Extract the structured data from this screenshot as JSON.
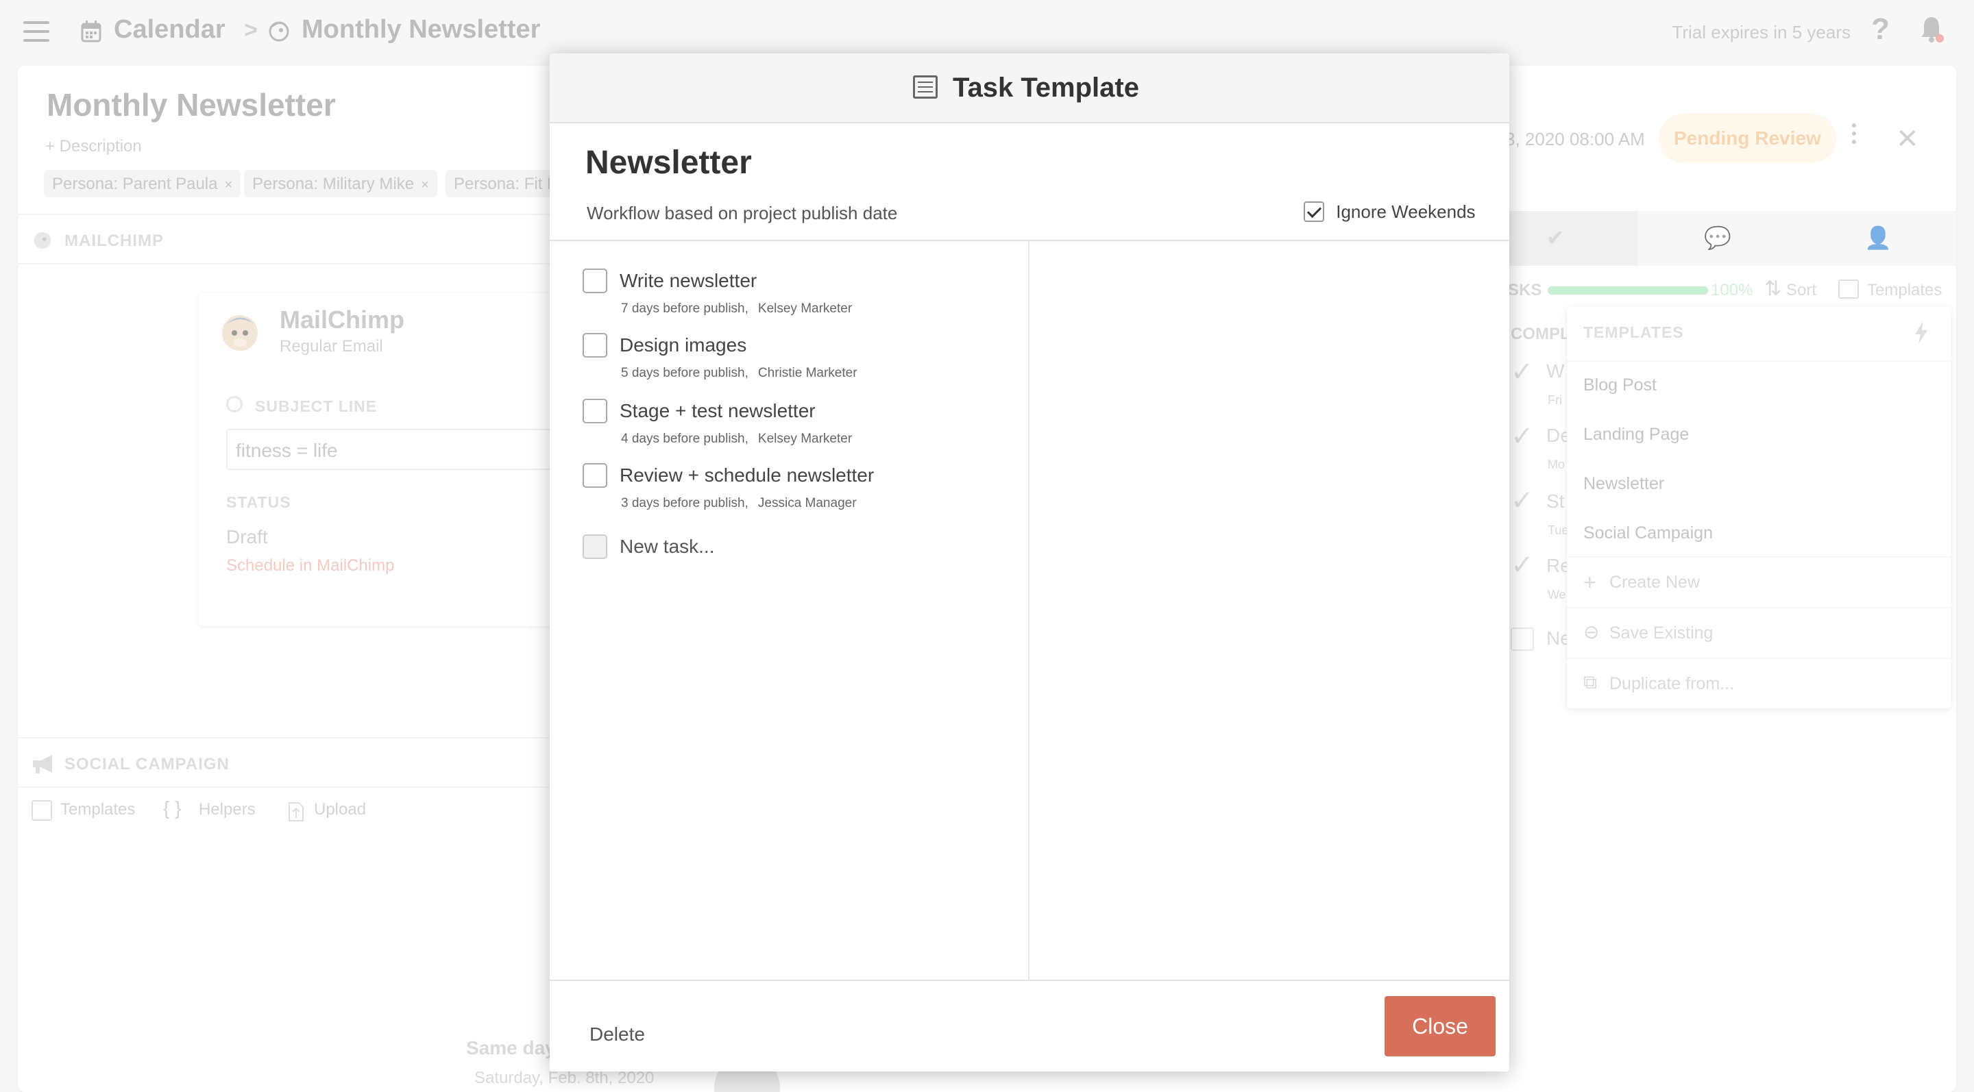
{
  "topbar": {
    "crumb_calendar": "Calendar",
    "crumb_separator": ">",
    "crumb_project": "Monthly Newsletter",
    "trial_text": "Trial expires in 5 years",
    "help_icon": "?"
  },
  "project": {
    "title": "Monthly Newsletter",
    "description_link": "+ Description",
    "tags": [
      "Persona: Parent Paula",
      "Persona: Military Mike",
      "Persona: Fit L"
    ],
    "tag_remove": "×",
    "date_text": "3, 2020 08:00 AM",
    "status_badge": "Pending Review",
    "close_icon": "✕"
  },
  "mailchimp_section": {
    "header": "MAILCHIMP",
    "card_title": "MailChimp",
    "card_subtitle": "Regular Email",
    "subject_label": "SUBJECT LINE",
    "subject_value": "fitness = life",
    "status_label": "STATUS",
    "status_value": "Draft",
    "schedule_link": "Schedule in MailChimp"
  },
  "social_section": {
    "header": "SOCIAL CAMPAIGN",
    "toolbar": {
      "templates": "Templates",
      "helpers_icon": "{ }",
      "helpers": "Helpers",
      "upload": "Upload"
    },
    "same_day": "Same day",
    "date": "Saturday, Feb. 8th, 2020"
  },
  "tasks_panel": {
    "tab_icons": [
      "✔",
      "💬",
      "👤"
    ],
    "tasks_label": "SKS",
    "progress": 1.0,
    "progress_text": "100%",
    "sort_label": "Sort",
    "templates_label": "Templates",
    "completed_label": "COMPL",
    "ghost_rows": [
      "W",
      "De",
      "St",
      "Re"
    ],
    "ghost_meta": [
      "Fri",
      "Mo",
      "Tue",
      "We"
    ],
    "ghost_new": "Ne"
  },
  "templates_dropdown": {
    "header": "TEMPLATES",
    "items": [
      "Blog Post",
      "Landing Page",
      "Newsletter",
      "Social Campaign"
    ],
    "actions": [
      "Create New",
      "Save Existing",
      "Duplicate from..."
    ],
    "action_icons": [
      "+",
      "⊖",
      "⧉"
    ]
  },
  "modal": {
    "title": "Task Template",
    "template_name": "Newsletter",
    "workflow_text": "Workflow based on project publish date",
    "ignore_weekends_label": "Ignore Weekends",
    "ignore_weekends_checked": true,
    "tasks": [
      {
        "name": "Write newsletter",
        "timing": "7 days before publish,",
        "assignee": "Kelsey Marketer"
      },
      {
        "name": "Design images",
        "timing": "5 days before publish,",
        "assignee": "Christie Marketer"
      },
      {
        "name": "Stage + test newsletter",
        "timing": "4 days before publish,",
        "assignee": "Kelsey Marketer"
      },
      {
        "name": "Review + schedule newsletter",
        "timing": "3 days before publish,",
        "assignee": "Jessica Manager"
      }
    ],
    "new_task_placeholder": "New task...",
    "delete_label": "Delete",
    "close_label": "Close"
  },
  "colors": {
    "accent": "#d6705a",
    "pending_bg": "#fdf1df",
    "pending_text": "#eeb978",
    "progress": "#9ee3b3"
  }
}
